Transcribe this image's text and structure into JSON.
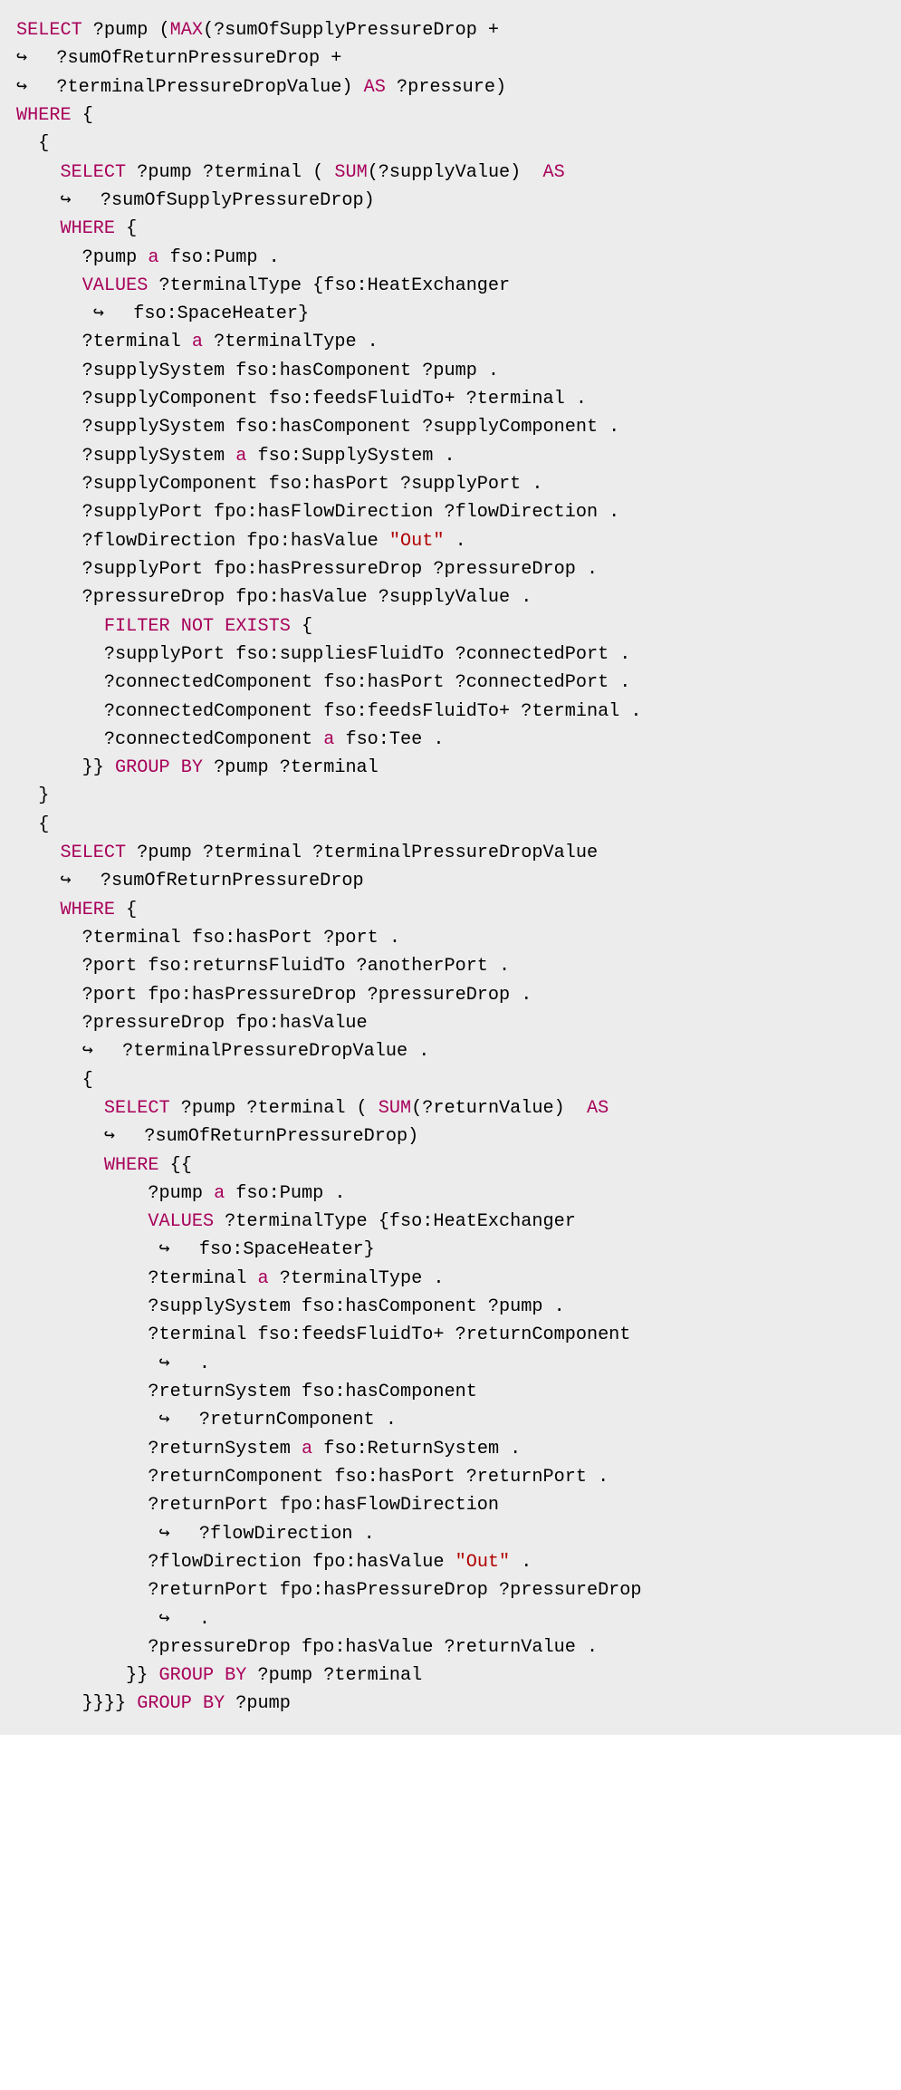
{
  "code": {
    "tokens": [
      {
        "t": "kw",
        "v": "SELECT"
      },
      {
        "t": "p",
        "v": " ?pump ("
      },
      {
        "t": "kw",
        "v": "MAX"
      },
      {
        "t": "p",
        "v": "(?sumOfSupplyPressureDrop +"
      },
      {
        "t": "nl"
      },
      {
        "t": "cont"
      },
      {
        "t": "p",
        "v": "  ?sumOfReturnPressureDrop +"
      },
      {
        "t": "nl"
      },
      {
        "t": "cont"
      },
      {
        "t": "p",
        "v": "  ?terminalPressureDropValue) "
      },
      {
        "t": "kw",
        "v": "AS"
      },
      {
        "t": "p",
        "v": " ?pressure)"
      },
      {
        "t": "nl"
      },
      {
        "t": "kw",
        "v": "WHERE"
      },
      {
        "t": "p",
        "v": " {"
      },
      {
        "t": "nl"
      },
      {
        "t": "p",
        "v": "  {"
      },
      {
        "t": "nl"
      },
      {
        "t": "p",
        "v": "    "
      },
      {
        "t": "kw",
        "v": "SELECT"
      },
      {
        "t": "p",
        "v": " ?pump ?terminal ( "
      },
      {
        "t": "kw",
        "v": "SUM"
      },
      {
        "t": "p",
        "v": "(?supplyValue)  "
      },
      {
        "t": "kw",
        "v": "AS"
      },
      {
        "t": "nl"
      },
      {
        "t": "p",
        "v": "    "
      },
      {
        "t": "cont"
      },
      {
        "t": "p",
        "v": "  ?sumOfSupplyPressureDrop)"
      },
      {
        "t": "nl"
      },
      {
        "t": "p",
        "v": "    "
      },
      {
        "t": "kw",
        "v": "WHERE"
      },
      {
        "t": "p",
        "v": " {"
      },
      {
        "t": "nl"
      },
      {
        "t": "p",
        "v": "      ?pump "
      },
      {
        "t": "kw",
        "v": "a"
      },
      {
        "t": "p",
        "v": " fso:Pump ."
      },
      {
        "t": "nl"
      },
      {
        "t": "p",
        "v": "      "
      },
      {
        "t": "kw",
        "v": "VALUES"
      },
      {
        "t": "p",
        "v": " ?terminalType {fso:HeatExchanger"
      },
      {
        "t": "nl"
      },
      {
        "t": "p",
        "v": "       "
      },
      {
        "t": "cont"
      },
      {
        "t": "p",
        "v": "  fso:SpaceHeater}"
      },
      {
        "t": "nl"
      },
      {
        "t": "p",
        "v": "      ?terminal "
      },
      {
        "t": "kw",
        "v": "a"
      },
      {
        "t": "p",
        "v": " ?terminalType ."
      },
      {
        "t": "nl"
      },
      {
        "t": "p",
        "v": "      ?supplySystem fso:hasComponent ?pump ."
      },
      {
        "t": "nl"
      },
      {
        "t": "p",
        "v": "      ?supplyComponent fso:feedsFluidTo+ ?terminal ."
      },
      {
        "t": "nl"
      },
      {
        "t": "p",
        "v": "      ?supplySystem fso:hasComponent ?supplyComponent ."
      },
      {
        "t": "nl"
      },
      {
        "t": "p",
        "v": "      ?supplySystem "
      },
      {
        "t": "kw",
        "v": "a"
      },
      {
        "t": "p",
        "v": " fso:SupplySystem ."
      },
      {
        "t": "nl"
      },
      {
        "t": "p",
        "v": "      ?supplyComponent fso:hasPort ?supplyPort ."
      },
      {
        "t": "nl"
      },
      {
        "t": "p",
        "v": "      ?supplyPort fpo:hasFlowDirection ?flowDirection ."
      },
      {
        "t": "nl"
      },
      {
        "t": "p",
        "v": "      ?flowDirection fpo:hasValue "
      },
      {
        "t": "str",
        "v": "\"Out\""
      },
      {
        "t": "p",
        "v": " ."
      },
      {
        "t": "nl"
      },
      {
        "t": "p",
        "v": "      ?supplyPort fpo:hasPressureDrop ?pressureDrop ."
      },
      {
        "t": "nl"
      },
      {
        "t": "p",
        "v": "      ?pressureDrop fpo:hasValue ?supplyValue ."
      },
      {
        "t": "nl"
      },
      {
        "t": "p",
        "v": "        "
      },
      {
        "t": "kw",
        "v": "FILTER"
      },
      {
        "t": "p",
        "v": " "
      },
      {
        "t": "kw",
        "v": "NOT"
      },
      {
        "t": "p",
        "v": " "
      },
      {
        "t": "kw",
        "v": "EXISTS"
      },
      {
        "t": "p",
        "v": " {"
      },
      {
        "t": "nl"
      },
      {
        "t": "p",
        "v": "        ?supplyPort fso:suppliesFluidTo ?connectedPort ."
      },
      {
        "t": "nl"
      },
      {
        "t": "p",
        "v": "        ?connectedComponent fso:hasPort ?connectedPort ."
      },
      {
        "t": "nl"
      },
      {
        "t": "p",
        "v": "        ?connectedComponent fso:feedsFluidTo+ ?terminal ."
      },
      {
        "t": "nl"
      },
      {
        "t": "p",
        "v": "        ?connectedComponent "
      },
      {
        "t": "kw",
        "v": "a"
      },
      {
        "t": "p",
        "v": " fso:Tee ."
      },
      {
        "t": "nl"
      },
      {
        "t": "p",
        "v": "      }} "
      },
      {
        "t": "kw",
        "v": "GROUP BY"
      },
      {
        "t": "p",
        "v": " ?pump ?terminal"
      },
      {
        "t": "nl"
      },
      {
        "t": "p",
        "v": "  }"
      },
      {
        "t": "nl"
      },
      {
        "t": "p",
        "v": "  {"
      },
      {
        "t": "nl"
      },
      {
        "t": "p",
        "v": "    "
      },
      {
        "t": "kw",
        "v": "SELECT"
      },
      {
        "t": "p",
        "v": " ?pump ?terminal ?terminalPressureDropValue"
      },
      {
        "t": "nl"
      },
      {
        "t": "p",
        "v": "    "
      },
      {
        "t": "cont"
      },
      {
        "t": "p",
        "v": "  ?sumOfReturnPressureDrop"
      },
      {
        "t": "nl"
      },
      {
        "t": "p",
        "v": "    "
      },
      {
        "t": "kw",
        "v": "WHERE"
      },
      {
        "t": "p",
        "v": " {"
      },
      {
        "t": "nl"
      },
      {
        "t": "p",
        "v": "      ?terminal fso:hasPort ?port ."
      },
      {
        "t": "nl"
      },
      {
        "t": "p",
        "v": "      ?port fso:returnsFluidTo ?anotherPort ."
      },
      {
        "t": "nl"
      },
      {
        "t": "p",
        "v": "      ?port fpo:hasPressureDrop ?pressureDrop ."
      },
      {
        "t": "nl"
      },
      {
        "t": "p",
        "v": "      ?pressureDrop fpo:hasValue"
      },
      {
        "t": "nl"
      },
      {
        "t": "p",
        "v": "      "
      },
      {
        "t": "cont"
      },
      {
        "t": "p",
        "v": "  ?terminalPressureDropValue ."
      },
      {
        "t": "nl"
      },
      {
        "t": "p",
        "v": "      {"
      },
      {
        "t": "nl"
      },
      {
        "t": "p",
        "v": "        "
      },
      {
        "t": "kw",
        "v": "SELECT"
      },
      {
        "t": "p",
        "v": " ?pump ?terminal ( "
      },
      {
        "t": "kw",
        "v": "SUM"
      },
      {
        "t": "p",
        "v": "(?returnValue)  "
      },
      {
        "t": "kw",
        "v": "AS"
      },
      {
        "t": "nl"
      },
      {
        "t": "p",
        "v": "        "
      },
      {
        "t": "cont"
      },
      {
        "t": "p",
        "v": "  ?sumOfReturnPressureDrop)"
      },
      {
        "t": "nl"
      },
      {
        "t": "p",
        "v": "        "
      },
      {
        "t": "kw",
        "v": "WHERE"
      },
      {
        "t": "p",
        "v": " {{"
      },
      {
        "t": "nl"
      },
      {
        "t": "p",
        "v": "            ?pump "
      },
      {
        "t": "kw",
        "v": "a"
      },
      {
        "t": "p",
        "v": " fso:Pump ."
      },
      {
        "t": "nl"
      },
      {
        "t": "p",
        "v": "            "
      },
      {
        "t": "kw",
        "v": "VALUES"
      },
      {
        "t": "p",
        "v": " ?terminalType {fso:HeatExchanger"
      },
      {
        "t": "nl"
      },
      {
        "t": "p",
        "v": "             "
      },
      {
        "t": "cont"
      },
      {
        "t": "p",
        "v": "  fso:SpaceHeater}"
      },
      {
        "t": "nl"
      },
      {
        "t": "p",
        "v": "            ?terminal "
      },
      {
        "t": "kw",
        "v": "a"
      },
      {
        "t": "p",
        "v": " ?terminalType ."
      },
      {
        "t": "nl"
      },
      {
        "t": "p",
        "v": "            ?supplySystem fso:hasComponent ?pump ."
      },
      {
        "t": "nl"
      },
      {
        "t": "p",
        "v": "            ?terminal fso:feedsFluidTo+ ?returnComponent"
      },
      {
        "t": "nl"
      },
      {
        "t": "p",
        "v": "             "
      },
      {
        "t": "cont"
      },
      {
        "t": "p",
        "v": "  ."
      },
      {
        "t": "nl"
      },
      {
        "t": "p",
        "v": "            ?returnSystem fso:hasComponent"
      },
      {
        "t": "nl"
      },
      {
        "t": "p",
        "v": "             "
      },
      {
        "t": "cont"
      },
      {
        "t": "p",
        "v": "  ?returnComponent ."
      },
      {
        "t": "nl"
      },
      {
        "t": "p",
        "v": "            ?returnSystem "
      },
      {
        "t": "kw",
        "v": "a"
      },
      {
        "t": "p",
        "v": " fso:ReturnSystem ."
      },
      {
        "t": "nl"
      },
      {
        "t": "p",
        "v": "            ?returnComponent fso:hasPort ?returnPort ."
      },
      {
        "t": "nl"
      },
      {
        "t": "p",
        "v": "            ?returnPort fpo:hasFlowDirection"
      },
      {
        "t": "nl"
      },
      {
        "t": "p",
        "v": "             "
      },
      {
        "t": "cont"
      },
      {
        "t": "p",
        "v": "  ?flowDirection ."
      },
      {
        "t": "nl"
      },
      {
        "t": "p",
        "v": "            ?flowDirection fpo:hasValue "
      },
      {
        "t": "str",
        "v": "\"Out\""
      },
      {
        "t": "p",
        "v": " ."
      },
      {
        "t": "nl"
      },
      {
        "t": "p",
        "v": "            ?returnPort fpo:hasPressureDrop ?pressureDrop"
      },
      {
        "t": "nl"
      },
      {
        "t": "p",
        "v": "             "
      },
      {
        "t": "cont"
      },
      {
        "t": "p",
        "v": "  ."
      },
      {
        "t": "nl"
      },
      {
        "t": "p",
        "v": "            ?pressureDrop fpo:hasValue ?returnValue ."
      },
      {
        "t": "nl"
      },
      {
        "t": "p",
        "v": "          }} "
      },
      {
        "t": "kw",
        "v": "GROUP BY"
      },
      {
        "t": "p",
        "v": " ?pump ?terminal"
      },
      {
        "t": "nl"
      },
      {
        "t": "p",
        "v": "      }}}} "
      },
      {
        "t": "kw",
        "v": "GROUP BY"
      },
      {
        "t": "p",
        "v": " ?pump"
      }
    ]
  }
}
